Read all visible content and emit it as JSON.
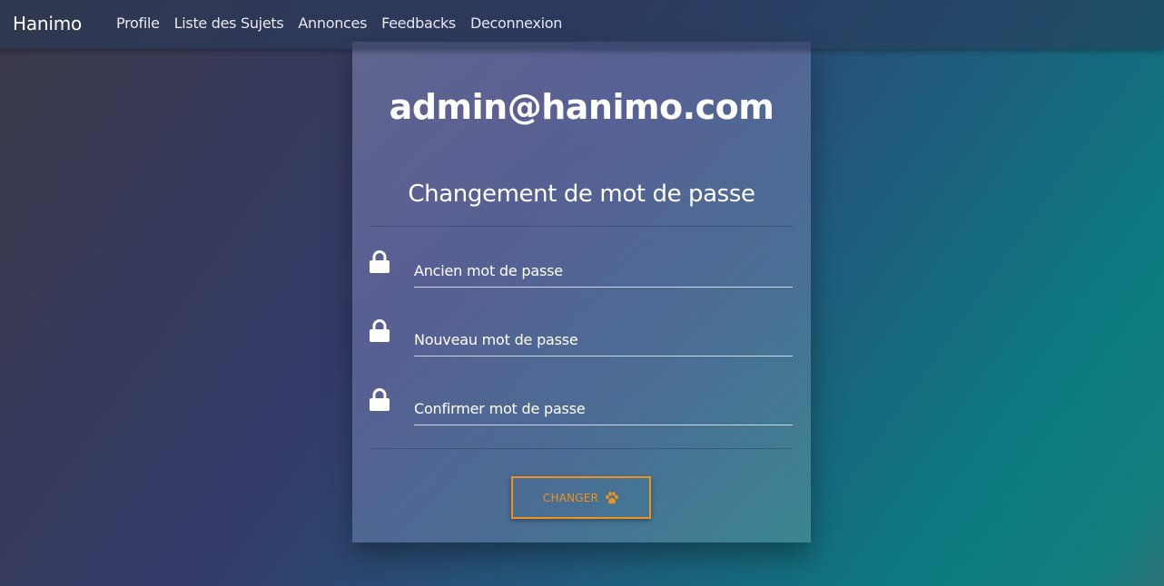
{
  "navbar": {
    "brand": "Hanimo",
    "links": [
      {
        "label": "Profile"
      },
      {
        "label": "Liste des Sujets"
      },
      {
        "label": "Annonces"
      },
      {
        "label": "Feedbacks"
      },
      {
        "label": "Deconnexion"
      }
    ]
  },
  "card": {
    "email": "admin@hanimo.com",
    "subtitle": "Changement de mot de passe",
    "fields": [
      {
        "placeholder": "Ancien mot de passe",
        "value": "",
        "icon": "lock-icon"
      },
      {
        "placeholder": "Nouveau mot de passe",
        "value": "",
        "icon": "lock-icon"
      },
      {
        "placeholder": "Confirmer mot de passe",
        "value": "",
        "icon": "lock-icon"
      }
    ],
    "submit": {
      "label": "CHANGER",
      "icon": "paw-icon"
    }
  },
  "colors": {
    "accent": "#f0921e",
    "text": "#ffffff"
  }
}
